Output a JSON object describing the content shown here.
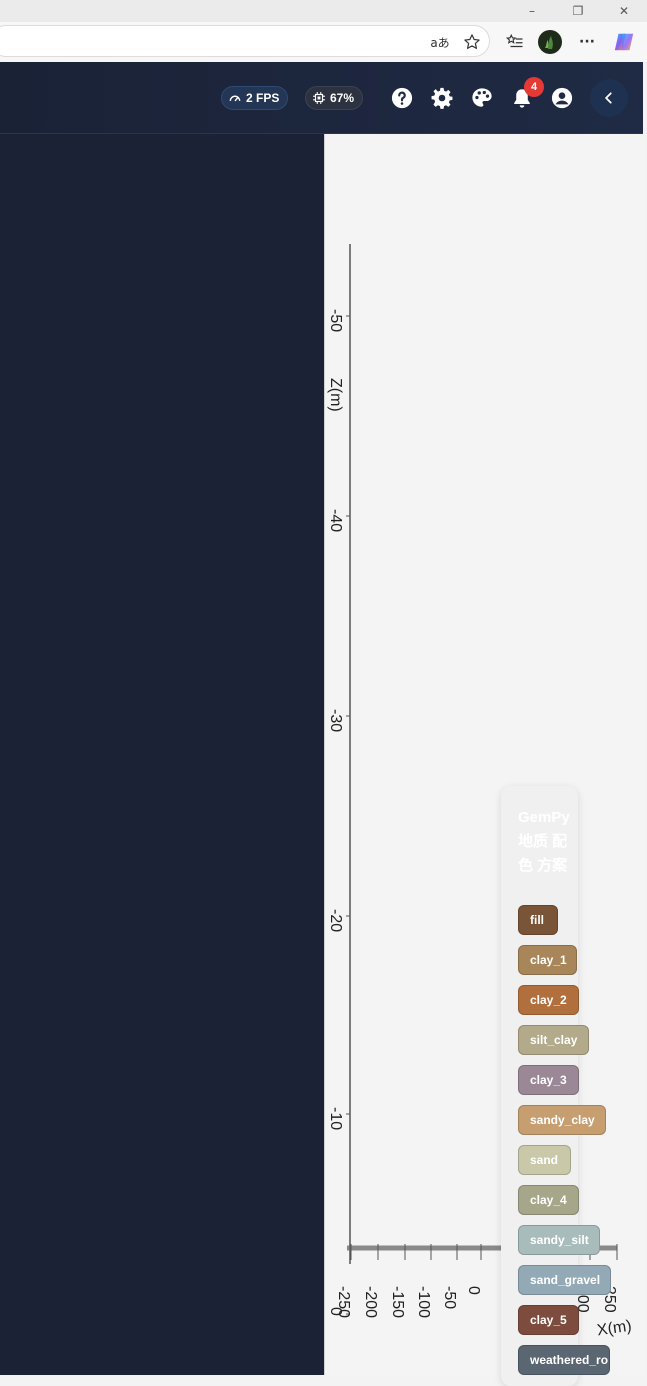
{
  "window_controls": {
    "minimize": "–",
    "restore": "❐",
    "close": "✕"
  },
  "browser": {
    "translate_icon": "translate-icon",
    "favorite_icon": "star-icon",
    "favorites_icon": "favorites-list-icon",
    "profile_icon": "profile-avatar-icon",
    "more_label": "···",
    "copilot_icon": "copilot-icon"
  },
  "header": {
    "fps_label": "2 FPS",
    "cpu_label": "67%",
    "help_icon": "help-icon",
    "settings_icon": "gear-icon",
    "palette_icon": "palette-icon",
    "notifications_icon": "bell-icon",
    "notification_count": "4",
    "account_icon": "account-icon",
    "collapse_icon": "chevron-left-icon"
  },
  "viewport": {
    "z_axis_label": "Z(m)",
    "x_axis_label": "X(m)",
    "z_ticks": [
      "-50",
      "-40",
      "-30",
      "-20",
      "-10",
      "0"
    ],
    "x_ticks": [
      "-250",
      "-200",
      "-150",
      "-100",
      "-50",
      "0",
      "200",
      "250"
    ]
  },
  "legend": {
    "title": "GemPy 地质 配色 方案",
    "items": [
      {
        "label": "fill",
        "color": "#7a5436"
      },
      {
        "label": "clay_1",
        "color": "#a8865a"
      },
      {
        "label": "clay_2",
        "color": "#b06f3c"
      },
      {
        "label": "silt_clay",
        "color": "#b2aa8a"
      },
      {
        "label": "clay_3",
        "color": "#9a8897"
      },
      {
        "label": "sandy_clay",
        "color": "#c79e70"
      },
      {
        "label": "sand",
        "color": "#c9c9a9"
      },
      {
        "label": "clay_4",
        "color": "#a6a68a"
      },
      {
        "label": "sandy_silt",
        "color": "#a9bcbc"
      },
      {
        "label": "sand_gravel",
        "color": "#93a9b6"
      },
      {
        "label": "clay_5",
        "color": "#7d4c3e"
      },
      {
        "label": "weathered_ro",
        "color": "#5a6672"
      }
    ]
  }
}
